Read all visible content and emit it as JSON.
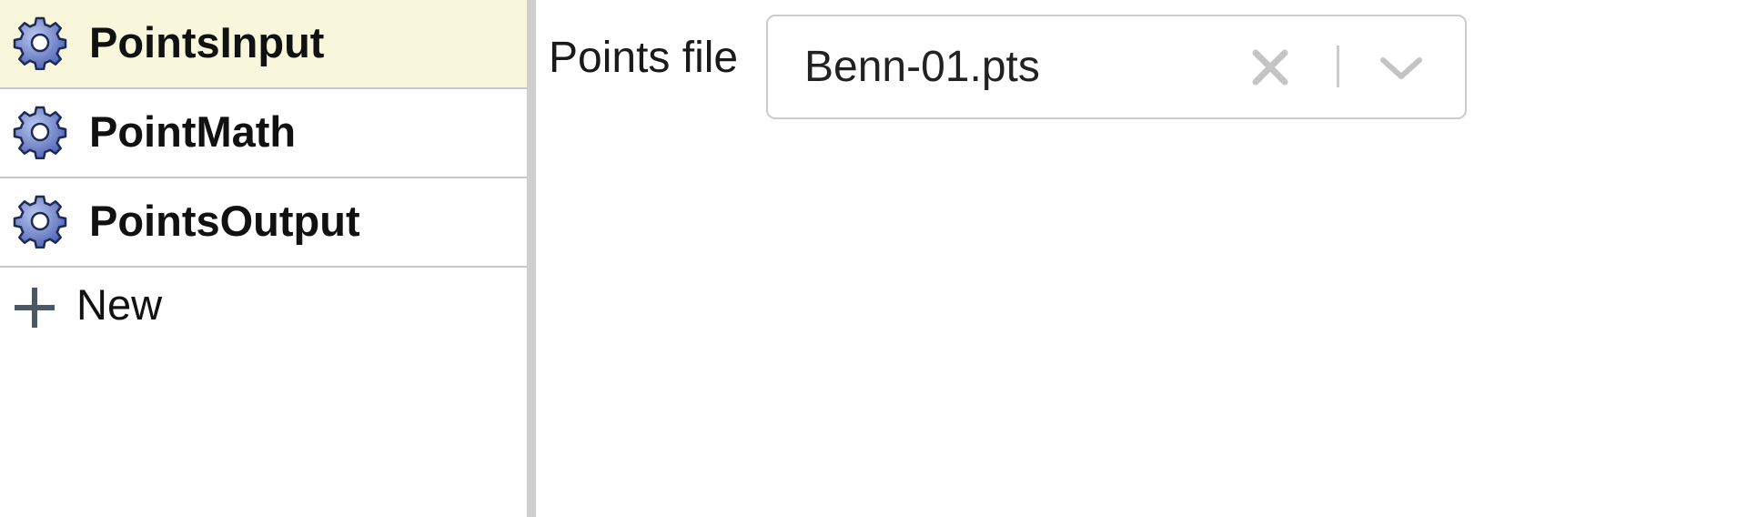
{
  "sidebar": {
    "items": [
      {
        "label": "PointsInput",
        "icon": "gear-icon",
        "selected": true
      },
      {
        "label": "PointMath",
        "icon": "gear-icon",
        "selected": false
      },
      {
        "label": "PointsOutput",
        "icon": "gear-icon",
        "selected": false
      }
    ],
    "new_item": {
      "label": "New",
      "icon": "plus-icon"
    }
  },
  "main": {
    "points_file": {
      "label": "Points file",
      "value": "Benn-01.pts",
      "clear_icon": "close-icon",
      "dropdown_icon": "chevron-down-icon"
    }
  },
  "colors": {
    "selected_bg": "#f8f7dc",
    "gear_fill": "#6b7fc4",
    "gear_stroke": "#1e2a55",
    "divider": "#c8c8c8",
    "splitter": "#cfcfcf",
    "select_border": "#cccccc",
    "icon_gray": "#c4c4c4"
  }
}
